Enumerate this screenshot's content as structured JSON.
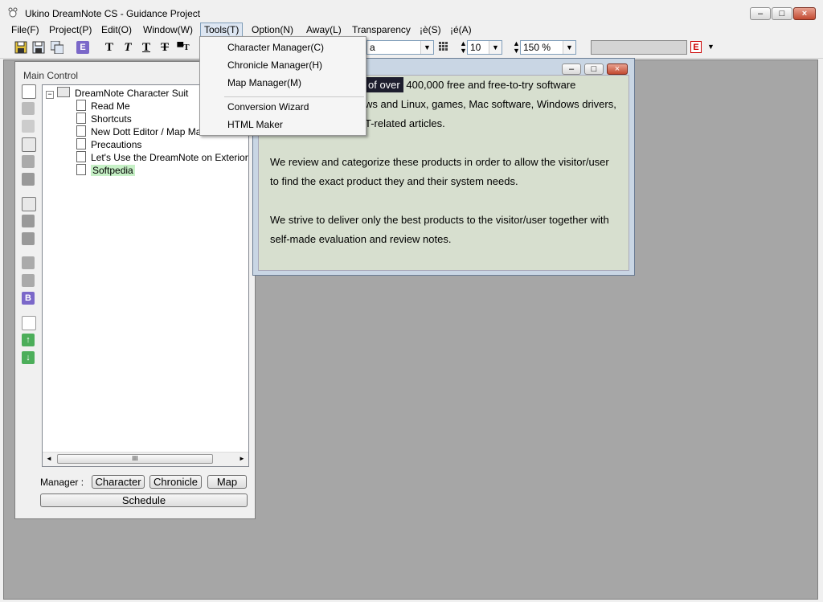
{
  "window": {
    "title": "Ukino DreamNote CS - Guidance Project",
    "caption_min": "–",
    "caption_max": "□",
    "caption_close": "×"
  },
  "menubar": {
    "items": [
      "File(F)",
      "Project(P)",
      "Edit(O)",
      "Window(W)",
      "Tools(T)",
      "Option(N)",
      "Away(L)",
      "Transparency",
      "¡è(S)",
      "¡é(A)"
    ]
  },
  "toolbar": {
    "font_partial": "a",
    "font_size": "10",
    "zoom": "150 %",
    "color_badge": "E",
    "style_badge": "E"
  },
  "tools_menu": {
    "items": [
      "Character Manager(C)",
      "Chronicle Manager(H)",
      "Map Manager(M)",
      "Conversion Wizard",
      "HTML Maker"
    ]
  },
  "main_control": {
    "title": "Main Control",
    "tree": {
      "root": "DreamNote Character Suit",
      "children": [
        "Read Me",
        "Shortcuts",
        "New Dott Editor / Map Maker",
        "Precautions",
        "Let's Use the DreamNote on Exterior Com",
        "Softpedia"
      ]
    },
    "scroll_grip": "III",
    "manager_label": "Manager :",
    "buttons": {
      "character": "Character",
      "chronicle": "Chronicle",
      "map": "Map",
      "schedule": "Schedule"
    }
  },
  "note": {
    "highlight": "of over",
    "line1_rest": " 400,000 free and free-to-try software",
    "line2": "ws and Linux, games, Mac software, Windows drivers,",
    "line3": "T-related articles.",
    "line4": "We review and categorize these products in order to allow the visitor/user",
    "line5": "to find the exact product they and their system needs.",
    "line6": "We strive to deliver only the best products to the visitor/user together with",
    "line7": "self-made evaluation and review notes."
  },
  "colors": {
    "workspace": "#a6a6a6",
    "note_bg": "#d7dfcf",
    "selection": "#c6f0c6",
    "highlight_bg": "#1e1e2e"
  }
}
